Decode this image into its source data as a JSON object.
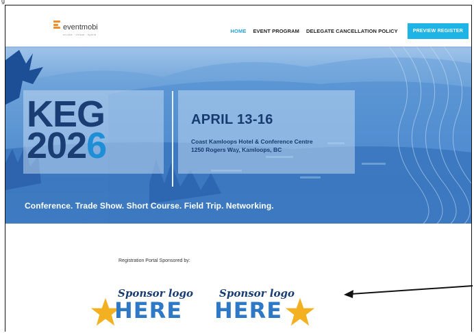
{
  "top_label": "g",
  "header": {
    "logo": {
      "name": "eventmobi",
      "tagline": "on-site · virtual · hybrid"
    },
    "nav": [
      {
        "label": "HOME",
        "active": true
      },
      {
        "label": "EVENT PROGRAM",
        "active": false
      },
      {
        "label": "DELEGATE CANCELLATION POLICY",
        "active": false
      }
    ],
    "cta_label": "PREVIEW REGISTER"
  },
  "hero": {
    "title_line1": "KEG",
    "title_line2_prefix": "202",
    "title_line2_accent": "6",
    "date": "APRIL 13-16",
    "venue_line1": "Coast Kamloops Hotel & Conference Centre",
    "venue_line2": "1250 Rogers Way, Kamloops, BC",
    "tagline": "Conference. Trade Show. Short Course. Field Trip. Networking."
  },
  "sponsors": {
    "label": "Registration Portal Sponsored by:",
    "logos": [
      {
        "script": "Sponsor logo",
        "word": "HERE"
      },
      {
        "script": "Sponsor logo",
        "word": "HERE"
      }
    ]
  },
  "colors": {
    "accent": "#1eb4e6",
    "navy": "#1a3d73",
    "star": "#f3b122",
    "hero_blue": "#3c79c2"
  }
}
